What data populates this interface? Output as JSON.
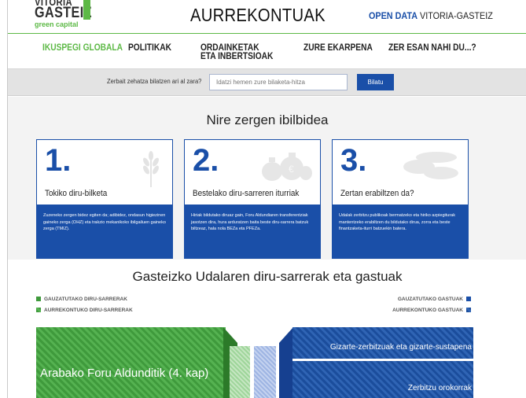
{
  "header": {
    "logo_top_text": "VITORIA",
    "logo_main_text": "GASTEIZ",
    "logo_sub_text": "green capital",
    "title": "AURREKONTUAK",
    "open_data_bold": "OPEN DATA",
    "open_data_rest": " VITORIA-GASTEIZ"
  },
  "nav": {
    "items": [
      {
        "label": "IKUSPEGI GLOBALA"
      },
      {
        "label": "POLITIKAK"
      },
      {
        "label": "ORDAINKETAK ETA INBERTSIOAK"
      },
      {
        "label": "ZURE EKARPENA"
      },
      {
        "label": "ZER ESAN NAHI DU...?"
      }
    ]
  },
  "search": {
    "label": "Zerbait zehatza bilatzen ari al zara?",
    "placeholder": "Idatzi hemen zure bilaketa-hitza",
    "button": "Bilatu"
  },
  "itinerary": {
    "title": "Nire zergen ibilbidea",
    "cards": [
      {
        "number": "1.",
        "title": "Tokiko diru-bilketa",
        "icon": "wheat-icon",
        "body": "Zuzeneko zergen bidez egiten da; adibidez, ondasun higiezinen gaineko zerga (OHZ) eta trakzio mekanikoko ibilgailuen gaineko zerga (TMIZ)."
      },
      {
        "number": "2.",
        "title": "Bestelako diru-sarreren iturriak",
        "icon": "money-bags-icon",
        "body": "Hiriak bildutako diruaz gain, Foru Aldundiaren transferentziak jasotzen dira, hura arduratzen baita beste diru-sarrera batzuk biltzeaz, hala nola BEZa eta PFEZa."
      },
      {
        "number": "3.",
        "title": "Zertan erabiltzen da?",
        "icon": "bread-icon",
        "body": "Udalak zerbitzu publikoak bermatzeko eta hiriko azpiegiturak mantentzeko erabiltzen du bildutako dirua, zorra eta beste finantzaketa-iturri batzuekin batera."
      }
    ]
  },
  "budget": {
    "title": "Gasteizko Udalaren diru-sarrerak eta gastuak",
    "legend_left": [
      "GAUZATUTAKO DIRU-SARRERAK",
      "AURREKONTUKO DIRU-SARRERAK"
    ],
    "legend_right": [
      "GAUZATUTAKO GASTUAK",
      "AURREKONTUKO GASTUAK"
    ],
    "income_label": "Arabako Foru Aldunditik (4. kap)",
    "expense_labels": [
      "Gizarte-zerbitzuak eta gizarte-sustapena",
      "Zerbitzu orokorrak"
    ]
  },
  "colors": {
    "accent_green": "#5db946",
    "accent_blue": "#1a4fa8"
  }
}
